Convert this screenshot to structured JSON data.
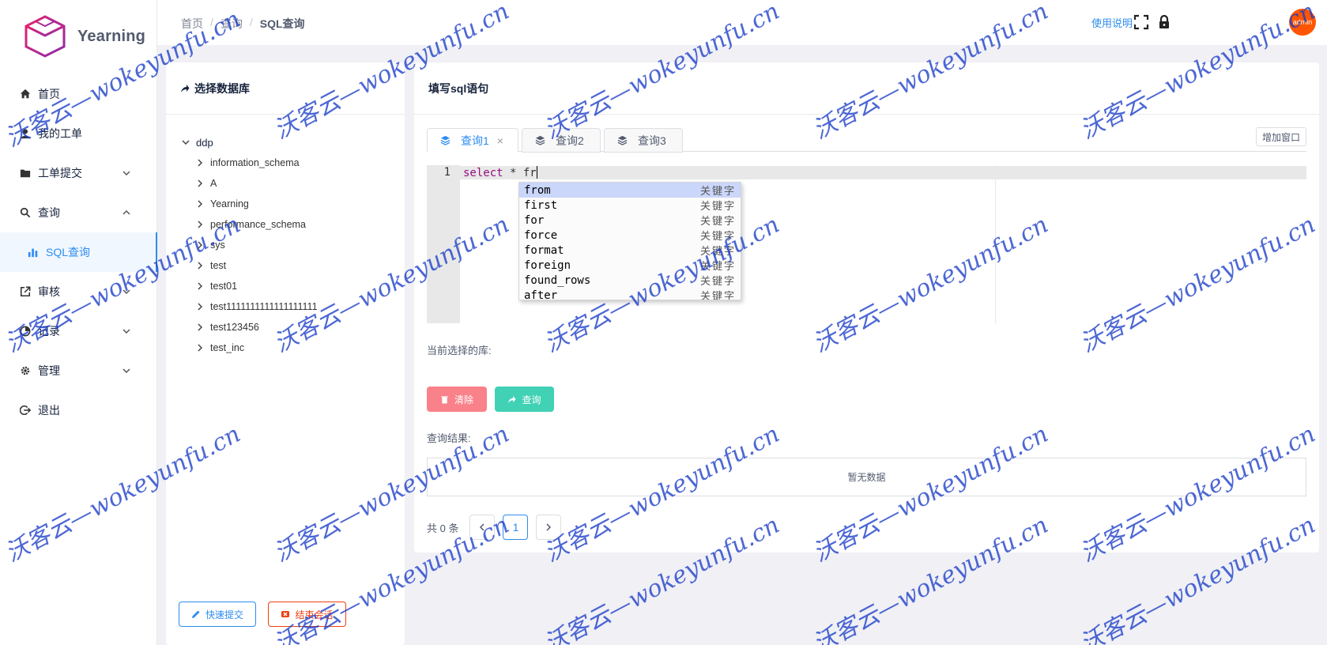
{
  "app": {
    "logo_text": "Yearning"
  },
  "sidebar": {
    "items": [
      {
        "label": "首页",
        "icon": "home-icon"
      },
      {
        "label": "我的工单",
        "icon": "user-icon"
      },
      {
        "label": "工单提交",
        "icon": "folder-icon",
        "expandable": true
      },
      {
        "label": "查询",
        "icon": "search-icon",
        "expandable": true,
        "expanded": true
      },
      {
        "label": "SQL查询",
        "icon": "bar-chart-icon",
        "active": true
      },
      {
        "label": "审核",
        "icon": "external-link-icon",
        "expandable": true
      },
      {
        "label": "记录",
        "icon": "pie-chart-icon",
        "expandable": true
      },
      {
        "label": "管理",
        "icon": "gear-icon",
        "expandable": true
      },
      {
        "label": "退出",
        "icon": "logout-icon"
      }
    ]
  },
  "header": {
    "breadcrumb": [
      "首页",
      "查询",
      "SQL查询"
    ],
    "breadcrumb_sep": "/",
    "help_link": "使用说明",
    "avatar_text": "admin"
  },
  "left_panel": {
    "title": "选择数据库",
    "tree_root": "ddp",
    "tree_children": [
      "information_schema",
      "A",
      "Yearning",
      "performance_schema",
      "sys",
      "test",
      "test01",
      "test1111111111111111111",
      "test123456",
      "test_inc"
    ],
    "quick_submit": "快速提交",
    "end_session": "结束会话"
  },
  "right_panel": {
    "title": "填写sql语句",
    "tabs": [
      "查询1",
      "查询2",
      "查询3"
    ],
    "tab_close": "×",
    "add_window": "增加窗口",
    "editor": {
      "line_number": "1",
      "keyword": "select",
      "rest": " * fr"
    },
    "autocomplete": {
      "meta": "关键字",
      "items": [
        "from",
        "first",
        "for",
        "force",
        "format",
        "foreign",
        "found_rows",
        "after"
      ]
    },
    "current_db_label": "当前选择的库:",
    "clear_button": "清除",
    "query_button": "查询",
    "result_label": "查询结果:",
    "no_data": "暂无数据",
    "pagination": {
      "total": "共 0 条",
      "current_page": "1"
    }
  },
  "watermark": {
    "text": "沃客云—wokeyunfu.cn"
  },
  "colors": {
    "primary": "#2d8cf0",
    "danger": "#ed4014",
    "clear": "#f9818a",
    "query": "#41d1b4",
    "avatar": "#ff5500"
  }
}
